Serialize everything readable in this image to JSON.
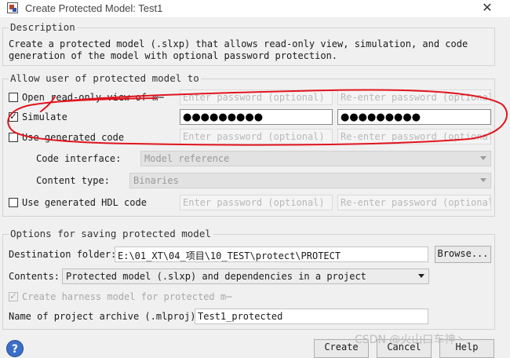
{
  "window": {
    "title": "Create Protected Model: Test1",
    "close_glyph": "✕"
  },
  "description": {
    "legend": "Description",
    "line1": "Create a protected model (.slxp) that allows read-only view, simulation, and code",
    "line2": "generation of the model with optional password protection."
  },
  "allow": {
    "legend": "Allow user of protected model to",
    "options": [
      {
        "label": "Open read-only view of m⋯",
        "checked": false,
        "pw1": "Enter password (optional)",
        "pw2": "Re-enter password (optional)"
      },
      {
        "label": "Simulate",
        "checked": true,
        "pw1": "●●●●●●●●●",
        "pw2": "●●●●●●●●●"
      },
      {
        "label": "Use generated code",
        "checked": false,
        "pw1": "Enter password (optional)",
        "pw2": "Re-enter password (optional)"
      },
      {
        "label": "Use generated HDL code",
        "checked": false,
        "pw1": "Enter password (optional)",
        "pw2": "Re-enter password (optional)"
      }
    ],
    "code_interface": {
      "label": "Code interface:",
      "value": "Model reference"
    },
    "content_type": {
      "label": "Content type:",
      "value": "Binaries"
    }
  },
  "options": {
    "legend": "Options for saving protected model",
    "destination": {
      "label": "Destination folder:",
      "value": "E:\\01_XT\\04_项目\\10_TEST\\protect\\PROTECT",
      "browse": "Browse..."
    },
    "contents": {
      "label": "Contents:",
      "value": "Protected model (.slxp) and dependencies in a project"
    },
    "harness": {
      "label": "Create harness model for protected m⋯",
      "checked": true
    },
    "archive": {
      "label": "Name of project archive (.mlproj):",
      "value": "Test1_protected"
    }
  },
  "buttons": {
    "create": "Create",
    "cancel": "Cancel",
    "help": "Help",
    "help_icon": "?"
  },
  "watermark": "CSDN @火山口车神丶",
  "annotation": {
    "color": "#e0141e"
  }
}
